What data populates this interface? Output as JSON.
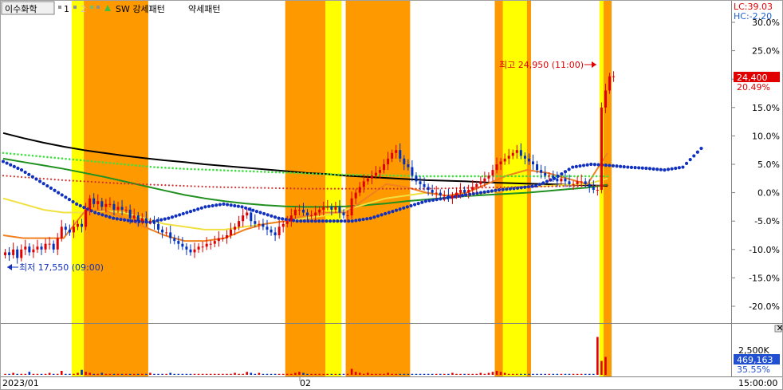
{
  "header": {
    "symbol": "이수화학",
    "item_1": "1",
    "item_2": "2",
    "indicator": "SW 강세패턴",
    "pattern_weak": "약세패턴"
  },
  "right_axis": {
    "lc_label": "LC:39.03",
    "hc_label": "HC:-2.20",
    "current_price": "24,400",
    "current_pct": "20.49%",
    "volume_tick": "2,500K",
    "current_volume": "469,163",
    "volume_pct": "35.55%"
  },
  "annotations": {
    "high": "최고 24,950 (11:00)",
    "low": "최저 17,550 (09:00)"
  },
  "x_axis": {
    "label_start": "2023/01",
    "label_mid": "02",
    "time_label": "15:00:00"
  },
  "colors": {
    "orange_band": "#ff9900",
    "yellow_band": "#ffff00",
    "candle_up": "#e00000",
    "candle_down": "#0030c0",
    "ma_black": "#000000",
    "ma_green": "#209020",
    "ma_yellow": "#f0e040",
    "ma_orange": "#f08020",
    "dots_blue": "#1030c0",
    "dots_green": "#40e040",
    "dots_red": "#d03030",
    "price_box": "#e00000",
    "volume_box": "#2050d0"
  },
  "chart_data": {
    "type": "line",
    "title": "이수화학",
    "ylim": [
      -22,
      30
    ],
    "y_ticks": [
      "30.0%",
      "25.0%",
      "20.0%",
      "15.0%",
      "10.0%",
      "5.0%",
      "0.0%",
      "-5.0%",
      "-10.0%",
      "-15.0%",
      "-20.0%"
    ],
    "y_tick_values": [
      30,
      25,
      20,
      15,
      10,
      5,
      0,
      -5,
      -10,
      -15,
      -20
    ],
    "x_ticks": [
      "2023/01",
      "02"
    ],
    "x_count": 150,
    "orange_bands": [
      [
        20,
        36
      ],
      [
        70,
        80
      ],
      [
        85,
        101
      ],
      [
        122,
        131
      ],
      [
        148,
        151
      ]
    ],
    "yellow_bands": [
      [
        17,
        20
      ],
      [
        80,
        84
      ],
      [
        124,
        130
      ],
      [
        148,
        149
      ]
    ],
    "price": [
      -10.5,
      -11,
      -10,
      -11.5,
      -10,
      -9.5,
      -10.5,
      -10,
      -9.5,
      -10,
      -9,
      -9,
      -10,
      -8,
      -6,
      -6.5,
      -7,
      -6,
      -5.5,
      -6,
      -3,
      -1,
      -2,
      -1.5,
      -2.5,
      -2,
      -2,
      -3,
      -2.5,
      -3,
      -3,
      -4.5,
      -4,
      -5,
      -4.5,
      -5,
      -5,
      -5.5,
      -6.5,
      -7,
      -7,
      -8,
      -8.5,
      -9,
      -9.5,
      -10,
      -10.5,
      -10,
      -9.5,
      -9.5,
      -9,
      -9,
      -8.5,
      -8,
      -8,
      -7.5,
      -6.5,
      -6,
      -5,
      -4,
      -3.5,
      -5,
      -5.5,
      -5.5,
      -6,
      -6.5,
      -7,
      -7.5,
      -6,
      -5.5,
      -5,
      -4,
      -3,
      -3,
      -3.5,
      -4,
      -4,
      -3.5,
      -3,
      -2.5,
      -2.5,
      -3,
      -2.5,
      -3.5,
      -4,
      -4,
      -1,
      0,
      1,
      2,
      2.5,
      3,
      3.5,
      4,
      5,
      6,
      7,
      7.5,
      6,
      5,
      4.5,
      3,
      2,
      1.5,
      1,
      0.5,
      0,
      0,
      -0.5,
      -0.5,
      -1,
      -0.5,
      0,
      0.5,
      0,
      0.5,
      1,
      1.5,
      2,
      2.5,
      3,
      4,
      5,
      5.5,
      6,
      6.5,
      7,
      7.5,
      6.5,
      6,
      5.5,
      5,
      4,
      3.5,
      3,
      3,
      2.5,
      2,
      2.5,
      2,
      1.5,
      1.5,
      2,
      2,
      1.5,
      1,
      0.5,
      0.5,
      15,
      18,
      20.5,
      20.5
    ],
    "ma_black": [
      10.5,
      9.6,
      8.8,
      8.1,
      7.5,
      7.0,
      6.5,
      6.1,
      5.7,
      5.4,
      5.0,
      4.7,
      4.4,
      4.1,
      3.8,
      3.5,
      3.3,
      3.0,
      2.8,
      2.6,
      2.4,
      2.2,
      2.1,
      2.0,
      1.8,
      1.7,
      1.6,
      1.5,
      1.4,
      1.3,
      1.2
    ],
    "ma_green": [
      6.0,
      5.4,
      4.8,
      4.2,
      3.5,
      2.8,
      2.0,
      1.2,
      0.4,
      -0.4,
      -1.0,
      -1.5,
      -1.9,
      -2.2,
      -2.4,
      -2.5,
      -2.5,
      -2.4,
      -2.2,
      -1.9,
      -1.5,
      -1.2,
      -0.9,
      -0.6,
      -0.4,
      -0.2,
      0.0,
      0.3,
      0.6,
      0.9,
      1.4
    ],
    "ma_yellow": [
      -1.0,
      -2.0,
      -3.0,
      -3.5,
      -3.5,
      -3.2,
      -3.5,
      -4.5,
      -5.5,
      -6.0,
      -6.5,
      -6.5,
      -6.0,
      -5.5,
      -5.0,
      -4.5,
      -4.0,
      -3.0,
      -2.0,
      -1.0,
      -0.5,
      0.0,
      -0.5,
      -0.5,
      0.0,
      0.5,
      1.0,
      1.2,
      1.4,
      1.5,
      2.5
    ],
    "ma_orange": [
      -7.5,
      -8.0,
      -8.0,
      -8.0,
      -3.5,
      -3.0,
      -4.5,
      -6.0,
      -7.5,
      -8.5,
      -8.5,
      -8.0,
      -6.5,
      -5.5,
      -5.0,
      -4.0,
      -3.5,
      -3.5,
      -1.0,
      1.5,
      1.0,
      0.0,
      -0.5,
      0.0,
      1.5,
      3.0,
      4.0,
      3.5,
      2.5,
      1.5,
      7.0
    ],
    "dots_blue": [
      5.5,
      4.0,
      2.0,
      0.0,
      -2.0,
      -3.5,
      -4.5,
      -5.0,
      -5.2,
      -4.5,
      -3.5,
      -2.5,
      -2.0,
      -2.5,
      -3.5,
      -4.5,
      -5.0,
      -5.0,
      -5.0,
      -5.0,
      -4.5,
      -3.5,
      -2.5,
      -1.5,
      -1.0,
      -0.5,
      0.0,
      0.5,
      0.8,
      1.2,
      2.5,
      4.5,
      5.0,
      4.8,
      4.5,
      4.3,
      4.0,
      4.5,
      7.8
    ],
    "dots_green": [
      7.0,
      6.5,
      6.0,
      5.5,
      5.0,
      4.5,
      4.2,
      4.0,
      3.8,
      3.6,
      3.4,
      3.2,
      3.1,
      3.0,
      2.9,
      2.9,
      2.9,
      2.9,
      2.9,
      2.9,
      2.9
    ],
    "dots_red": [
      3.0,
      2.6,
      2.2,
      1.9,
      1.6,
      1.4,
      1.2,
      1.0,
      0.9,
      0.8,
      0.7,
      0.7,
      0.7,
      0.7,
      0.7,
      0.8,
      0.9,
      1.0,
      1.1,
      1.2,
      1.3
    ],
    "volume": [
      1,
      1,
      2,
      1,
      1,
      1,
      3,
      1,
      1,
      1,
      1,
      2,
      1,
      1,
      4,
      1,
      1,
      1,
      2,
      5,
      3,
      2,
      1,
      1,
      2,
      1,
      1,
      1,
      1,
      1,
      1,
      1,
      1,
      1,
      1,
      1,
      2,
      1,
      1,
      1,
      1,
      2,
      1,
      1,
      1,
      1,
      1,
      1,
      1,
      1,
      1,
      1,
      1,
      1,
      1,
      1,
      1,
      2,
      1,
      1,
      3,
      2,
      1,
      2,
      1,
      1,
      1,
      1,
      1,
      1,
      1,
      1,
      2,
      3,
      2,
      1,
      1,
      1,
      1,
      1,
      1,
      1,
      1,
      1,
      1,
      1,
      6,
      3,
      2,
      1,
      2,
      1,
      1,
      1,
      1,
      2,
      1,
      1,
      1,
      1,
      1,
      1,
      1,
      1,
      1,
      1,
      1,
      1,
      1,
      1,
      1,
      2,
      1,
      1,
      1,
      1,
      1,
      1,
      2,
      1,
      2,
      3,
      4,
      3,
      2,
      1,
      1,
      1,
      1,
      1,
      1,
      1,
      1,
      1,
      1,
      1,
      1,
      1,
      1,
      1,
      1,
      1,
      1,
      1,
      1,
      1,
      1,
      38,
      14,
      18
    ],
    "volume_max": 40
  }
}
